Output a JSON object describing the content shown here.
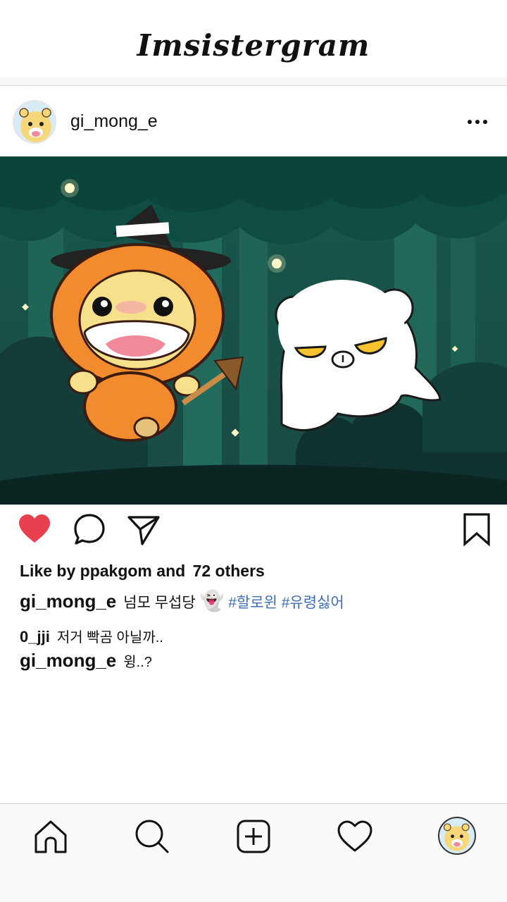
{
  "app": {
    "title": "Imsistergram"
  },
  "post": {
    "author": "gi_mong_e",
    "likes_prefix": "Like by",
    "likes_user": "ppakgom",
    "likes_and": "and",
    "likes_count_text": "72 others",
    "caption_user": "gi_mong_e",
    "caption_text": "넘모 무섭당",
    "caption_emoji": "👻",
    "hashtags": [
      "#할로윈",
      "#유령싫어"
    ],
    "liked": true
  },
  "comments": [
    {
      "user": "0_jji",
      "text": "저거 빡곰 아닐까.."
    },
    {
      "user": "gi_mong_e",
      "text": "윙..?"
    }
  ],
  "colors": {
    "like": "#e8404f",
    "hashtag": "#3d6fb6",
    "image_bg": "#1d5a4e"
  },
  "icons": {
    "post": [
      "more-icon",
      "heart-icon",
      "comment-icon",
      "share-icon",
      "bookmark-icon"
    ],
    "nav": [
      "home-icon",
      "search-icon",
      "add-icon",
      "activity-heart-icon",
      "profile-avatar"
    ]
  }
}
